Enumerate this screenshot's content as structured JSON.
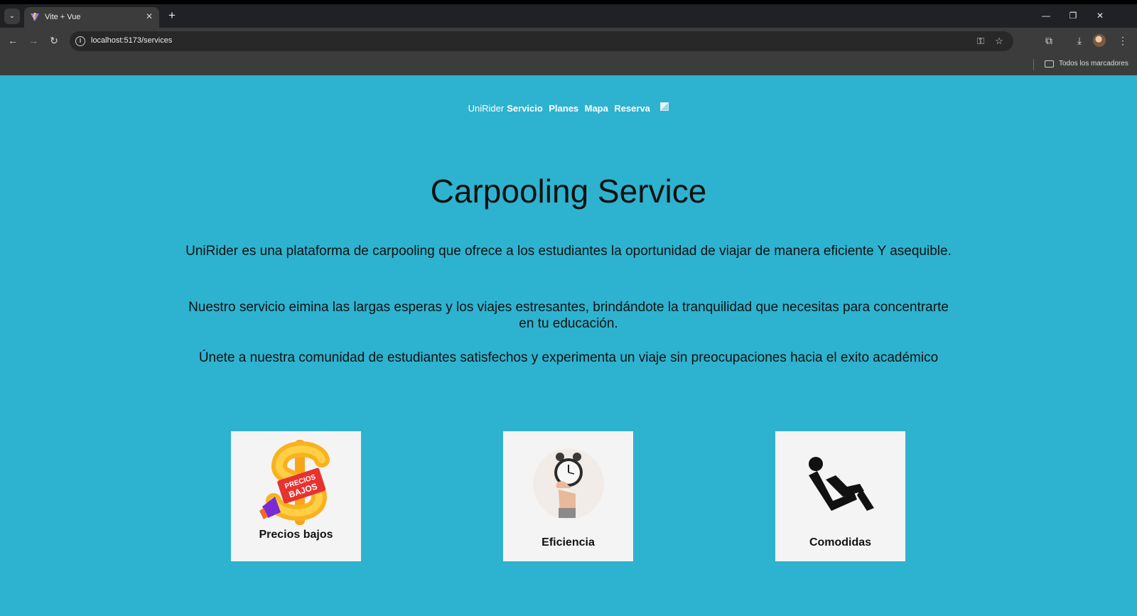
{
  "browser": {
    "tab_title": "Vite + Vue",
    "url": "localhost:5173/services",
    "bookmarks_label": "Todos los marcadores"
  },
  "nav": {
    "brand": "UniRider",
    "links": [
      "Servicio",
      "Planes",
      "Mapa",
      "Reserva"
    ]
  },
  "main": {
    "title": "Carpooling Service",
    "paragraphs": [
      "UniRider es una plataforma de carpooling que ofrece a los estudiantes la oportunidad de viajar de manera eficiente Y asequible.",
      "Nuestro servicio eimina las largas esperas y los viajes estresantes, brindándote la tranquilidad que necesitas para concentrarte en tu educación.",
      "Únete a nuestra comunidad de estudiantes satisfechos y experimenta un viaje sin preocupaciones hacia el exito académico"
    ]
  },
  "cards": [
    {
      "label": "Precios bajos",
      "icon": "dollar-sign-icon",
      "badge": "PRECIOS BAJOS"
    },
    {
      "label": "Eficiencia",
      "icon": "alarm-clock-icon"
    },
    {
      "label": "Comodidas",
      "icon": "reclining-seat-icon"
    }
  ],
  "colors": {
    "page_background": "#2db3cf",
    "card_background": "#f4f4f4",
    "browser_frame": "#3c3c3c"
  }
}
